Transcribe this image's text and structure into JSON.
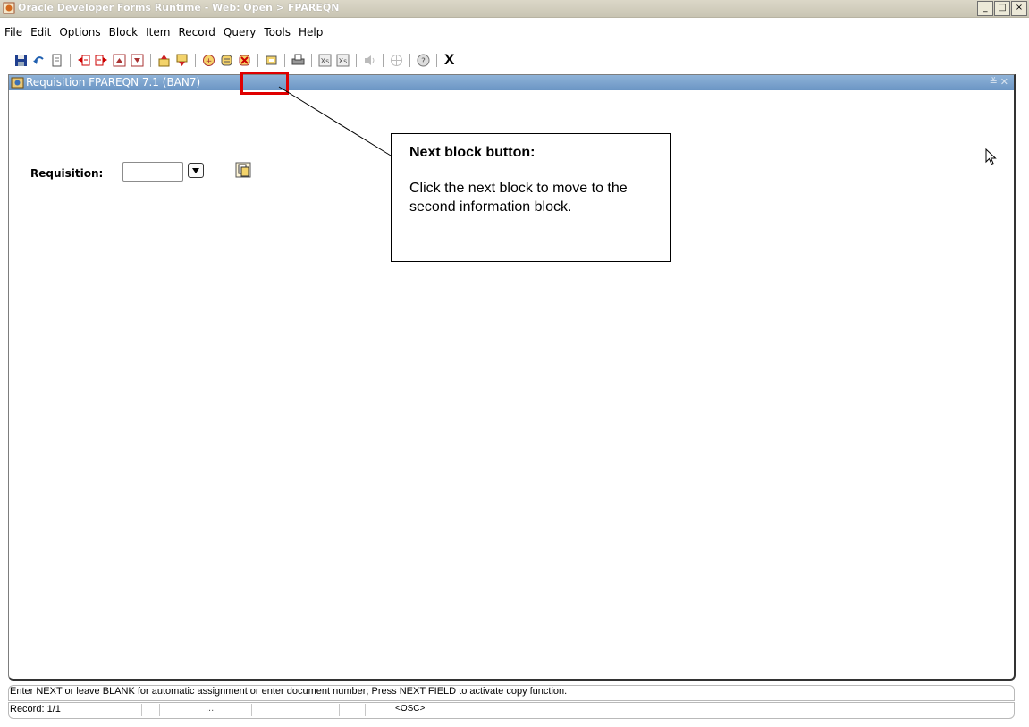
{
  "window": {
    "title": "Oracle Developer Forms Runtime - Web:  Open > FPAREQN",
    "controls": [
      "_",
      "□",
      "×"
    ]
  },
  "menu": [
    "File",
    "Edit",
    "Options",
    "Block",
    "Item",
    "Record",
    "Query",
    "Tools",
    "Help"
  ],
  "toolbar": {
    "groups": [
      [
        "save-icon",
        "rollback-icon",
        "print-doc-icon"
      ],
      [
        "previous-field-icon",
        "next-field-icon",
        "previous-record-icon",
        "next-record-icon"
      ],
      [
        "previous-block-icon",
        "next-block-icon"
      ],
      [
        "insert-record-icon",
        "remove-record-icon",
        "lock-record-icon"
      ],
      [
        "help-icon"
      ],
      [
        "print-icon"
      ],
      [
        "enter-query-icon",
        "execute-query-icon"
      ],
      [
        "sound-icon"
      ],
      [
        "move-icon"
      ],
      [
        "info-icon"
      ]
    ],
    "exit_label": "X"
  },
  "form": {
    "title": "Requisition  FPAREQN  7.1  (BAN7)",
    "requisition_label": "Requisition:",
    "requisition_value": ""
  },
  "callout": {
    "title": "Next block button:",
    "body": "Click the next block to move to the second information block."
  },
  "status": {
    "hint": "Enter NEXT or leave BLANK for automatic assignment or enter document number; Press NEXT FIELD to activate copy function.",
    "record": "Record: 1/1",
    "ellipsis": "...",
    "mode": "<OSC>"
  }
}
